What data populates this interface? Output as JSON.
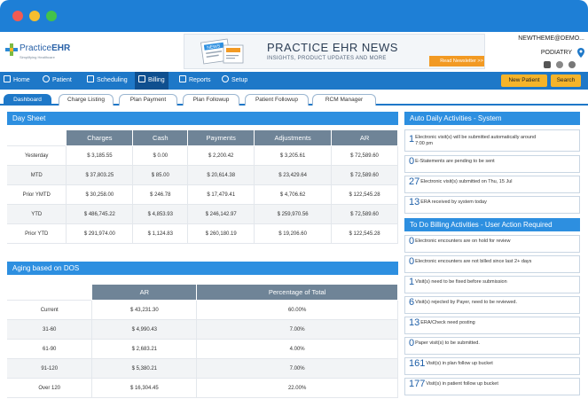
{
  "app": {
    "logo_brand": "Practice",
    "logo_brand_bold": "EHR",
    "logo_tagline": "Simplifying Healthcare",
    "user_name": "NEWTHEME@DEMO...",
    "specialty": "PODIATRY"
  },
  "banner": {
    "badge": "NEWS",
    "title": "PRACTICE EHR NEWS",
    "subtitle": "INSIGHTS, PRODUCT UPDATES AND MORE",
    "button": "Read Newsletter >>"
  },
  "nav": {
    "items": [
      {
        "label": "Home",
        "icon": "home-icon"
      },
      {
        "label": "Patient",
        "icon": "person-icon"
      },
      {
        "label": "Scheduling",
        "icon": "calendar-icon"
      },
      {
        "label": "Billing",
        "icon": "dollar-icon"
      },
      {
        "label": "Reports",
        "icon": "document-icon"
      },
      {
        "label": "Setup",
        "icon": "gear-icon"
      }
    ],
    "new_patient": "New Patient",
    "search": "Search"
  },
  "tabs": [
    "Dashboard",
    "Charge Listing",
    "Plan Payment",
    "Plan Followup",
    "Patient Followup",
    "RCM Manager"
  ],
  "day_sheet": {
    "title": "Day Sheet",
    "columns": [
      "Charges",
      "Cash",
      "Payments",
      "Adjustments",
      "AR"
    ],
    "rows": [
      {
        "label": "Yesterday",
        "values": [
          "$ 3,185.55",
          "$ 0.00",
          "$ 2,200.42",
          "$ 3,205.61",
          "$ 72,589.60"
        ]
      },
      {
        "label": "MTD",
        "values": [
          "$ 37,803.25",
          "$ 85.00",
          "$ 20,614.38",
          "$ 23,429.64",
          "$ 72,589.60"
        ]
      },
      {
        "label": "Prior YMTD",
        "values": [
          "$ 30,258.00",
          "$ 246.78",
          "$ 17,479.41",
          "$ 4,706.62",
          "$ 122,545.28"
        ]
      },
      {
        "label": "YTD",
        "values": [
          "$ 486,745.22",
          "$ 4,853.93",
          "$ 246,142.97",
          "$ 259,970.56",
          "$ 72,589.60"
        ]
      },
      {
        "label": "Prior YTD",
        "values": [
          "$ 291,974.00",
          "$ 1,124.83",
          "$ 260,180.19",
          "$ 19,206.60",
          "$ 122,545.28"
        ]
      }
    ]
  },
  "aging": {
    "title": "Aging based on DOS",
    "columns": [
      "AR",
      "Percentage of Total"
    ],
    "rows": [
      {
        "label": "Current",
        "values": [
          "$ 43,231.30",
          "60.00%"
        ]
      },
      {
        "label": "31-60",
        "values": [
          "$ 4,990.43",
          "7.00%"
        ]
      },
      {
        "label": "61-90",
        "values": [
          "$ 2,683.21",
          "4.00%"
        ]
      },
      {
        "label": "91-120",
        "values": [
          "$ 5,380.21",
          "7.00%"
        ]
      },
      {
        "label": "Over 120",
        "values": [
          "$ 16,304.45",
          "22.00%"
        ]
      }
    ]
  },
  "auto_activities": {
    "title": "Auto Daily Activities - System",
    "items": [
      {
        "count": "1",
        "text": "Electronic visit(s) will be submitted automatically around",
        "text2": "7:00 pm"
      },
      {
        "count": "0",
        "text": "E-Statements are pending to be sent"
      },
      {
        "count": "27",
        "text": "Electronic visit(s) submitted on Thu, 15 Jul"
      },
      {
        "count": "13",
        "text": "ERA received by system today"
      }
    ]
  },
  "todo_activities": {
    "title": "To Do Billing Activities - User Action Required",
    "items": [
      {
        "count": "0",
        "text": "Electronic encounters are on hold for review"
      },
      {
        "count": "0",
        "text": "Electronic encounters are not billed since last 2+ days"
      },
      {
        "count": "1",
        "text": "Visit(s) need to be fixed before submission"
      },
      {
        "count": "6",
        "text": "Visit(s) rejected by Payer, need to be reviewed."
      },
      {
        "count": "13",
        "text": "ERA/Check need posting"
      },
      {
        "count": "0",
        "text": "Paper visit(s) to be submitted."
      },
      {
        "count": "161",
        "text": "Visit(s) in plan follow up bucket"
      },
      {
        "count": "177",
        "text": "Visit(s) in patient follow up bucket"
      }
    ]
  },
  "colors": {
    "titlebar": "#1e7fd6",
    "nav": "#1e78c8",
    "panel_head": "#2d8fe0",
    "table_head": "#6f8497",
    "accent": "#f5b42a"
  }
}
